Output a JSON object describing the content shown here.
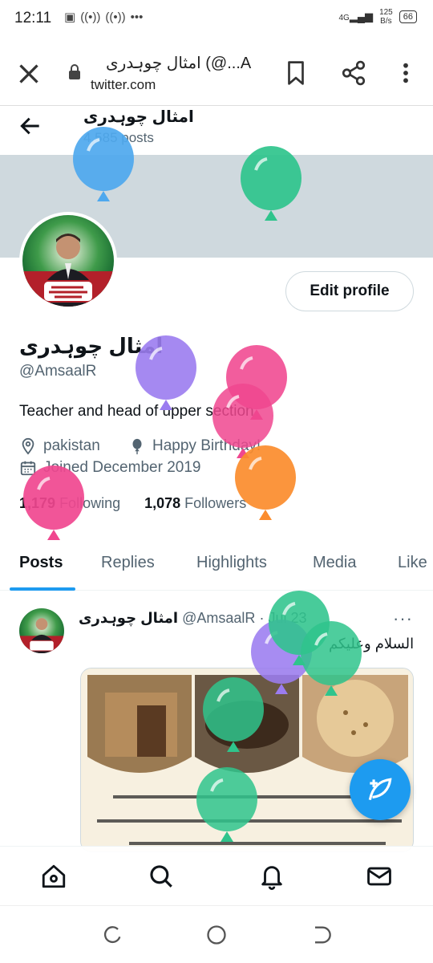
{
  "status_bar": {
    "time": "12:11",
    "network": "4G",
    "speed_value": "125",
    "speed_unit": "B/s",
    "battery": "66"
  },
  "browser": {
    "title": "امثال چوہدری (@...A",
    "url": "twitter.com"
  },
  "profile_header": {
    "name": "امثال چوہدری",
    "posts_count": "4,585 posts"
  },
  "profile": {
    "edit_button": "Edit profile",
    "name": "امثال چوہدری",
    "handle": "@AmsaalR",
    "bio": "Teacher and head of upper section",
    "location": "pakistan",
    "birthday": "Happy Birthday!",
    "joined": "Joined December 2019",
    "following_count": "1,179",
    "following_label": "Following",
    "followers_count": "1,078",
    "followers_label": "Followers"
  },
  "tabs": [
    {
      "label": "Posts",
      "active": true
    },
    {
      "label": "Replies",
      "active": false
    },
    {
      "label": "Highlights",
      "active": false
    },
    {
      "label": "Media",
      "active": false
    },
    {
      "label": "Like",
      "active": false
    }
  ],
  "post": {
    "author_name": "امثال چوہدری",
    "author_handle": "@AmsaalR",
    "separator": "·",
    "date": "Jul 23",
    "text": "السلام وعلیکم",
    "more": "···"
  },
  "colors": {
    "accent": "#1d9bf0",
    "banner": "#cfd9de",
    "muted": "#536471",
    "balloon_blue": "#4ea8ee",
    "balloon_green": "#2fc48c",
    "balloon_purple": "#9b7cf0",
    "balloon_pink": "#f0478f",
    "balloon_orange": "#fb8c2d"
  },
  "icons": {
    "close": "close-icon",
    "lock": "lock-icon",
    "bookmark": "bookmark-icon",
    "share": "share-icon",
    "menu": "more-vertical-icon",
    "back": "back-arrow-icon",
    "location": "location-pin-icon",
    "balloon": "balloon-icon",
    "calendar": "calendar-icon",
    "compose": "compose-icon",
    "home": "home-icon",
    "search": "search-icon",
    "notifications": "bell-icon",
    "messages": "mail-icon"
  }
}
